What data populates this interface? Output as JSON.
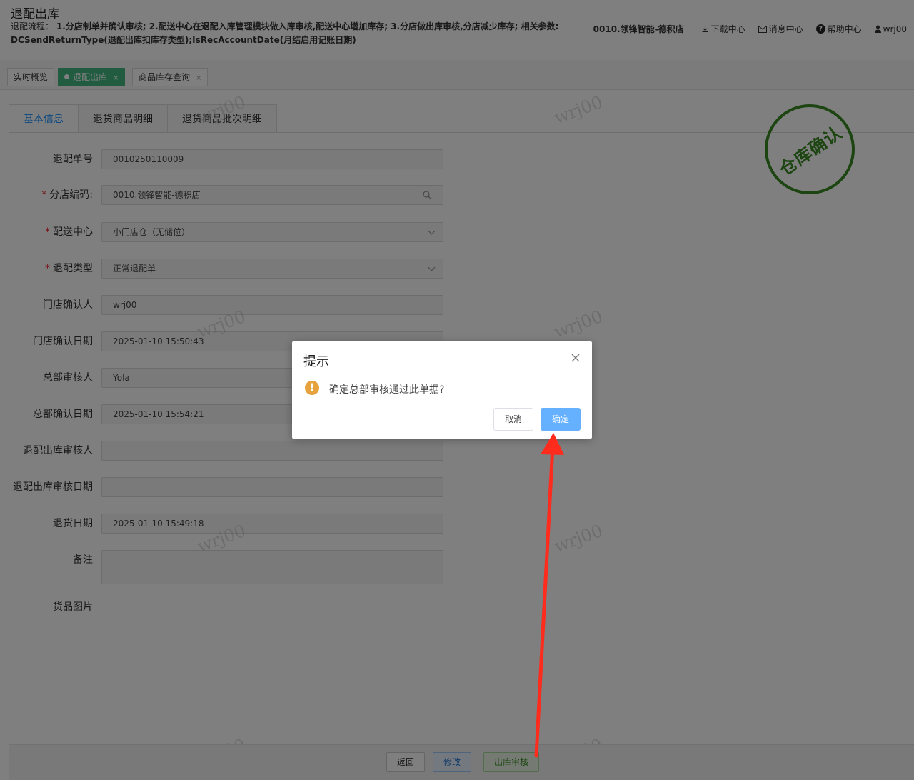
{
  "header": {
    "title": "退配出库",
    "process_prefix": "退配流程：",
    "process_line1_rest": "1.分店制单并确认审核; 2.配送中心在退配入库管理模块做入库审核,配送中心增加库存; 3.分店做出库审核,分店减少库存; 相关参数:",
    "process_line2": "DCSendReturnType(退配出库扣库存类型);IsRecAccountDate(月结启用记账日期)",
    "store": "0010.领锋智能-德积店",
    "download": "下载中心",
    "messages": "消息中心",
    "help": "帮助中心",
    "user": "wrj00"
  },
  "page_tabs": [
    {
      "label": "实时概览"
    },
    {
      "label": "退配出库",
      "close": "×"
    },
    {
      "label": "商品库存查询",
      "close": "×"
    }
  ],
  "inner_tabs": [
    {
      "label": "基本信息"
    },
    {
      "label": "退货商品明细"
    },
    {
      "label": "退货商品批次明细"
    }
  ],
  "form": {
    "return_no": {
      "label": "退配单号",
      "value": "0010250110009"
    },
    "store_code": {
      "label": "分店编码:",
      "value": "0010.领锋智能-德积店"
    },
    "dc": {
      "label": "配送中心",
      "value": "小门店仓（无储位）"
    },
    "return_type": {
      "label": "退配类型",
      "value": "正常退配单"
    },
    "store_confirmer": {
      "label": "门店确认人",
      "value": "wrj00"
    },
    "store_confirm_date": {
      "label": "门店确认日期",
      "value": "2025-01-10 15:50:43"
    },
    "hq_reviewer": {
      "label": "总部审核人",
      "value": "Yola"
    },
    "hq_confirm_date": {
      "label": "总部确认日期",
      "value": "2025-01-10 15:54:21"
    },
    "out_reviewer": {
      "label": "退配出库审核人",
      "value": ""
    },
    "out_review_date": {
      "label": "退配出库审核日期",
      "value": ""
    },
    "return_date": {
      "label": "退货日期",
      "value": "2025-01-10 15:49:18"
    },
    "remark": {
      "label": "备注",
      "value": ""
    },
    "images": {
      "label": "货品图片"
    }
  },
  "stamp": "仓库确认",
  "watermark": "wrj00",
  "footer": {
    "back": "返回",
    "edit": "修改",
    "out_review": "出库审核"
  },
  "dialog": {
    "title": "提示",
    "message": "确定总部审核通过此单据?",
    "icon": "!",
    "cancel": "取消",
    "confirm": "确定"
  },
  "colors": {
    "accent": "#1890ff",
    "active_tab": "#42b983",
    "stamp": "#3a8a25",
    "warning": "#e6a23c",
    "primary_button": "#66b1ff",
    "annotation_arrow": "#ff2b1c"
  }
}
